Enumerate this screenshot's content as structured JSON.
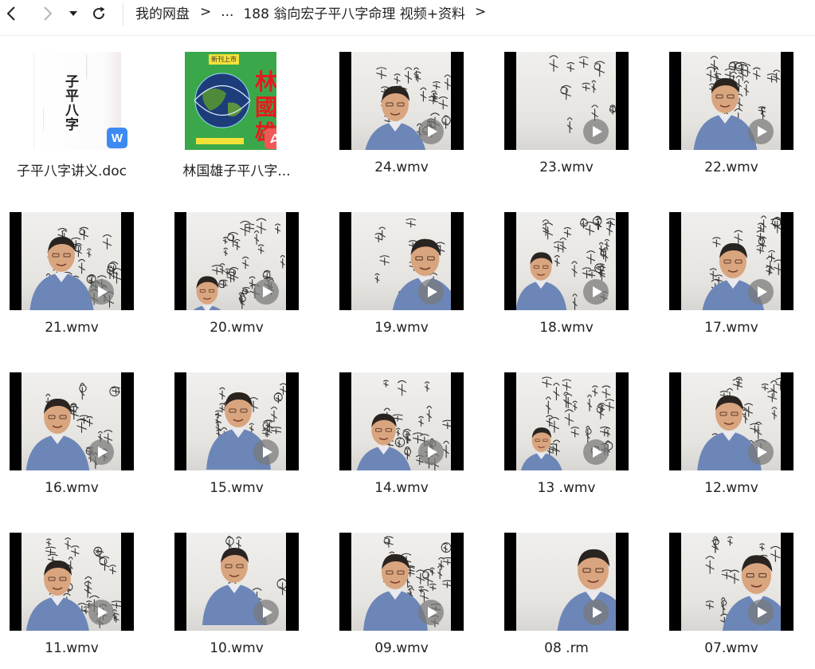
{
  "toolbar": {
    "back_icon": "chevron-left-icon",
    "forward_icon": "chevron-right-icon",
    "dropdown_icon": "caret-down-icon",
    "refresh_icon": "refresh-icon"
  },
  "breadcrumb": {
    "root": "我的网盘",
    "sep": ">",
    "ellipsis": "...",
    "current": "188 翁向宏子平八字命理 视频+资料",
    "trailing_sep": ">"
  },
  "files": [
    {
      "name": "子平八字讲义.doc",
      "type": "doc"
    },
    {
      "name": "林国雄子平八字...",
      "type": "pdf"
    },
    {
      "name": "24.wmv",
      "type": "video"
    },
    {
      "name": "23.wmv",
      "type": "video"
    },
    {
      "name": "22.wmv",
      "type": "video"
    },
    {
      "name": "21.wmv",
      "type": "video"
    },
    {
      "name": "20.wmv",
      "type": "video"
    },
    {
      "name": "19.wmv",
      "type": "video"
    },
    {
      "name": "18.wmv",
      "type": "video"
    },
    {
      "name": "17.wmv",
      "type": "video"
    },
    {
      "name": "16.wmv",
      "type": "video"
    },
    {
      "name": "15.wmv",
      "type": "video"
    },
    {
      "name": "14.wmv",
      "type": "video"
    },
    {
      "name": "13 .wmv",
      "type": "video"
    },
    {
      "name": "12.wmv",
      "type": "video"
    },
    {
      "name": "11.wmv",
      "type": "video"
    },
    {
      "name": "10.wmv",
      "type": "video"
    },
    {
      "name": "09.wmv",
      "type": "video"
    },
    {
      "name": "08 .rm",
      "type": "video"
    },
    {
      "name": "07.wmv",
      "type": "video"
    }
  ],
  "doc_thumb": {
    "title": "子平八字",
    "badge": "W"
  },
  "pdf_thumb": {
    "title": "林國雄",
    "tag": "新刊上市"
  },
  "colors": {
    "word_badge": "#3d8bf2",
    "pdf_badge": "#f25757",
    "pdf_cover_bg": "#3aa84a",
    "pdf_title": "#e8191e"
  }
}
